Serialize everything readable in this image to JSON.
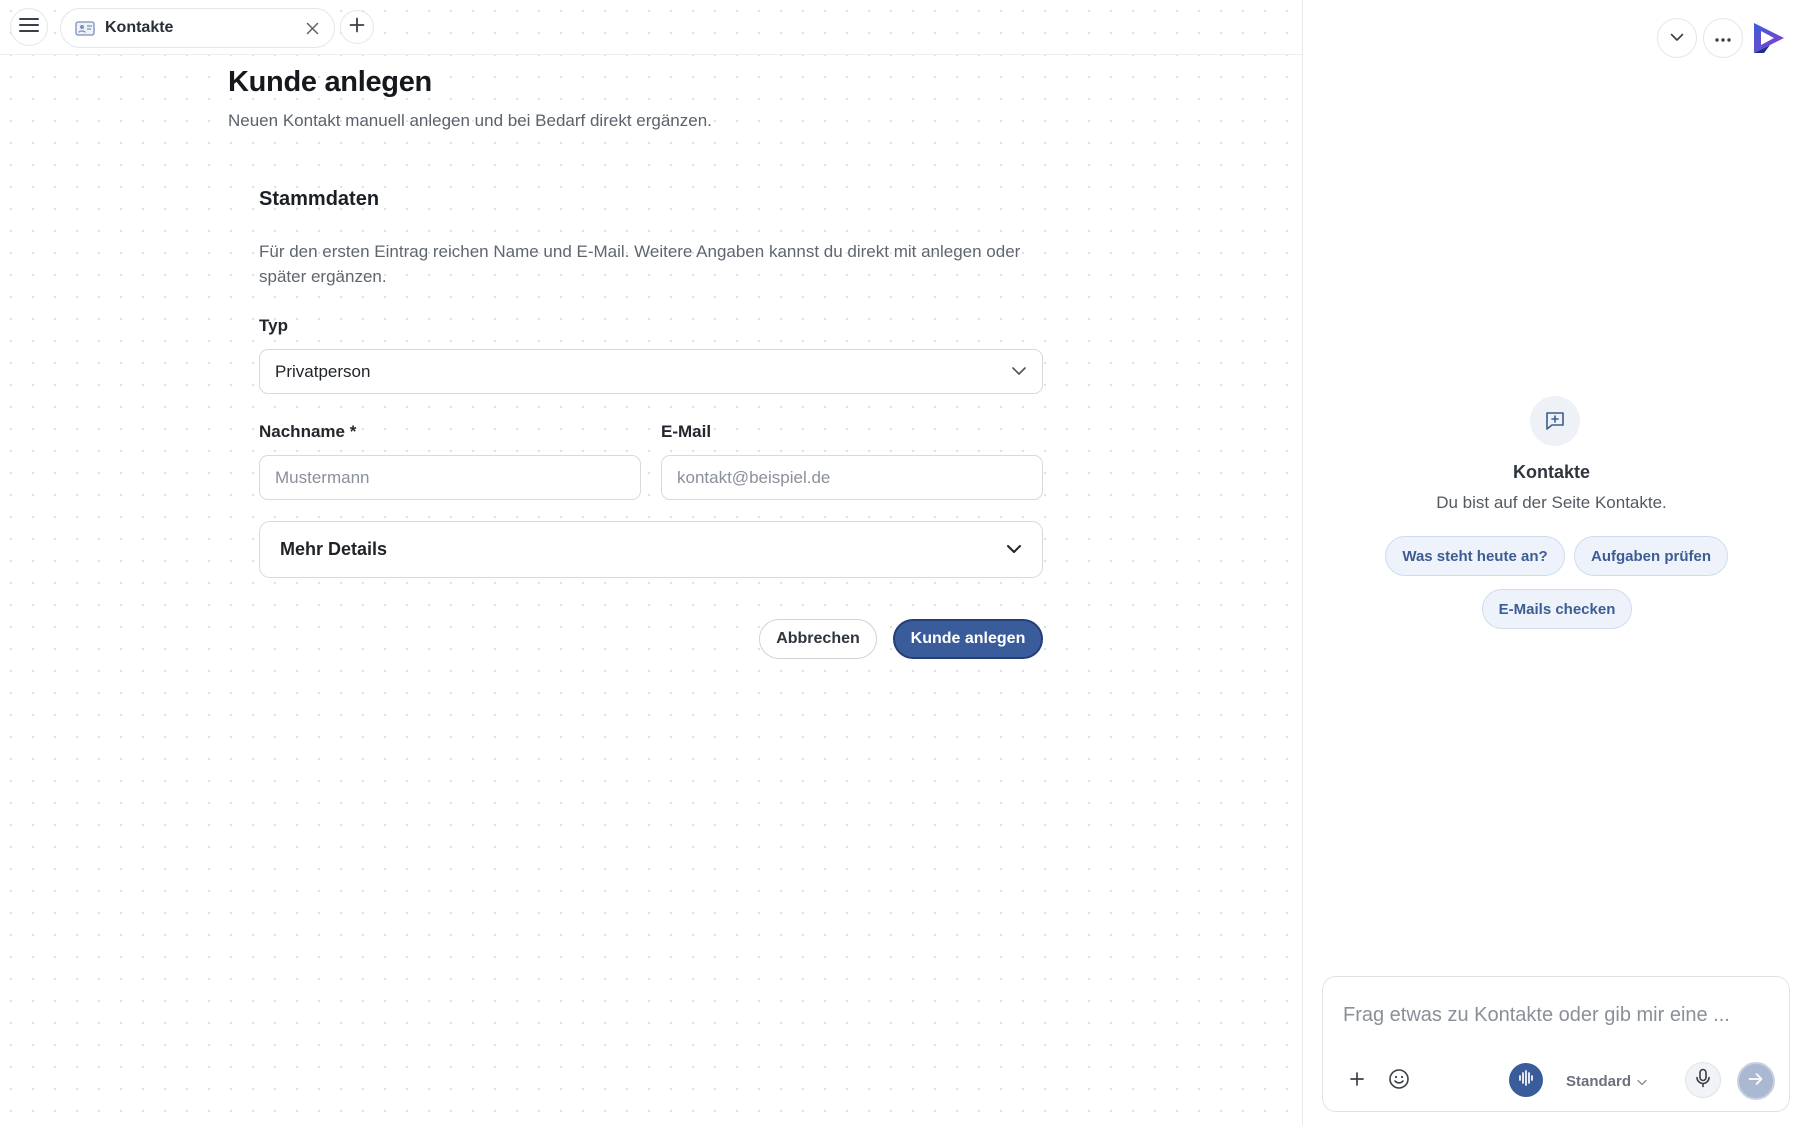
{
  "tabbar": {
    "menu_icon": "hamburger-menu-icon",
    "tab": {
      "label": "Kontakte",
      "icon": "contacts-card-icon",
      "close_icon": "close-icon"
    },
    "new_tab_icon": "plus-icon"
  },
  "page": {
    "title": "Kunde anlegen",
    "subtitle": "Neuen Kontakt manuell anlegen und bei Bedarf direkt ergänzen."
  },
  "form": {
    "section_title": "Stammdaten",
    "section_desc": "Für den ersten Eintrag reichen Name und E-Mail. Weitere Angaben kannst du direkt mit anlegen oder später ergänzen.",
    "type": {
      "label": "Typ",
      "value": "Privatperson"
    },
    "lastname": {
      "label": "Nachname *",
      "value": "",
      "placeholder": "Mustermann"
    },
    "email": {
      "label": "E-Mail",
      "value": "",
      "placeholder": "kontakt@beispiel.de"
    },
    "more_details_label": "Mehr Details",
    "cancel_label": "Abbrechen",
    "submit_label": "Kunde anlegen"
  },
  "assistant": {
    "title": "Kontakte",
    "subtitle": "Du bist auf der Seite Kontakte.",
    "suggestions": [
      "Was steht heute an?",
      "Aufgaben prüfen",
      "E-Mails checken"
    ],
    "composer": {
      "value": "",
      "placeholder": "Frag etwas zu Kontakte oder gib mir eine ...",
      "mode_label": "Standard"
    }
  },
  "colors": {
    "primary": "#3b5c9b",
    "chip_bg": "#eef3fb",
    "chip_text": "#3c5d93"
  }
}
